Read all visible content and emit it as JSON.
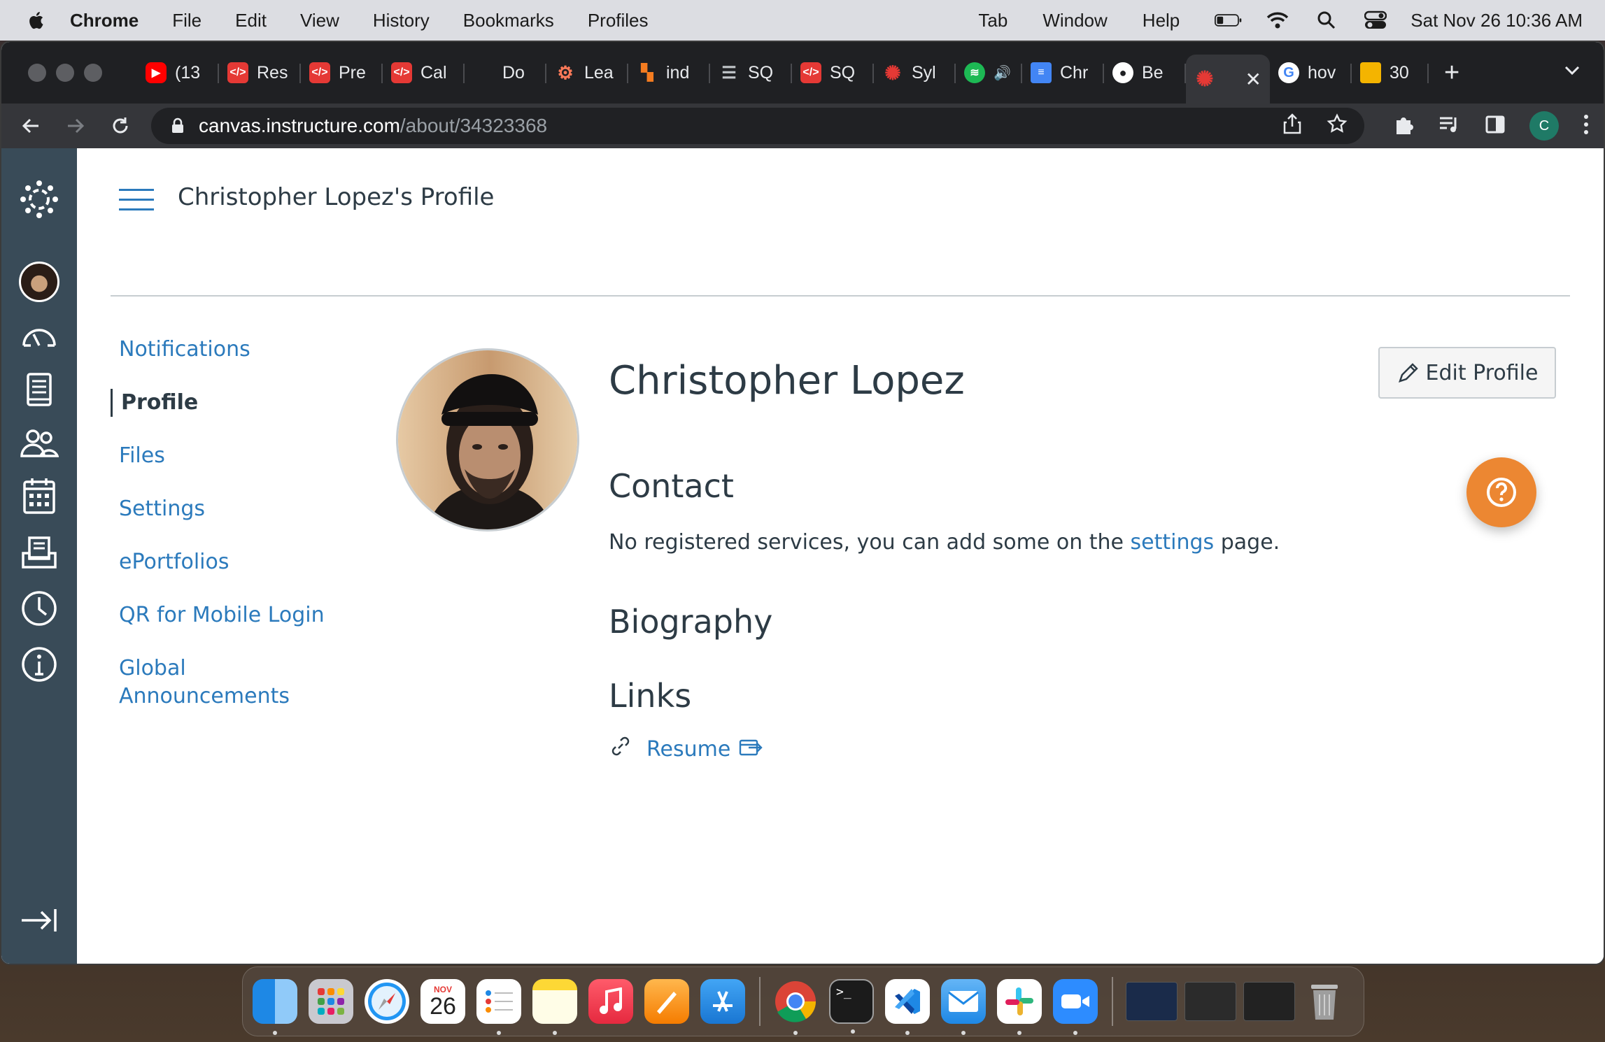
{
  "menubar": {
    "app": "Chrome",
    "items": [
      "File",
      "Edit",
      "View",
      "History",
      "Bookmarks",
      "Profiles"
    ],
    "right_items": [
      "Tab",
      "Window",
      "Help"
    ],
    "datetime": "Sat Nov 26  10:36 AM"
  },
  "tabs": [
    {
      "label": "(13",
      "icon": "youtube-icon",
      "color": "#ff0000"
    },
    {
      "label": "Res",
      "icon": "code-shield-icon",
      "color": "#e53935"
    },
    {
      "label": "Pre",
      "icon": "code-shield-icon",
      "color": "#e53935"
    },
    {
      "label": "Cal",
      "icon": "code-shield-icon",
      "color": "#e53935"
    },
    {
      "label": "Do",
      "icon": "blank-icon",
      "color": "#1f2023"
    },
    {
      "label": "Lea",
      "icon": "hubspot-icon",
      "color": "#ff7a59"
    },
    {
      "label": "ind",
      "icon": "orange-squares-icon",
      "color": "#f47c20"
    },
    {
      "label": "SQ",
      "icon": "database-icon",
      "color": "#9aa0a6"
    },
    {
      "label": "SQ",
      "icon": "code-shield-icon",
      "color": "#e53935"
    },
    {
      "label": "Syl",
      "icon": "canvas-icon",
      "color": "#e53935"
    },
    {
      "label": "",
      "icon": "spotify-icon",
      "color": "#1db954"
    },
    {
      "label": "Chr",
      "icon": "docs-icon",
      "color": "#4285f4"
    },
    {
      "label": "Be",
      "icon": "github-icon",
      "color": "#ffffff"
    },
    {
      "label": "",
      "icon": "canvas-icon",
      "color": "#e53935",
      "active": true
    },
    {
      "label": "hov",
      "icon": "google-icon",
      "color": "#ffffff"
    },
    {
      "label": "30",
      "icon": "slides-icon",
      "color": "#f4b400"
    }
  ],
  "address": {
    "host": "canvas.instructure.com",
    "path": "/about/34323368"
  },
  "profile_initial": "C",
  "page": {
    "title": "Christopher Lopez's Profile",
    "subnav": [
      {
        "label": "Notifications",
        "active": false
      },
      {
        "label": "Profile",
        "active": true
      },
      {
        "label": "Files",
        "active": false
      },
      {
        "label": "Settings",
        "active": false
      },
      {
        "label": "ePortfolios",
        "active": false
      },
      {
        "label": "QR for Mobile Login",
        "active": false
      },
      {
        "label": "Global Announcements",
        "active": false
      }
    ],
    "user_name": "Christopher Lopez",
    "edit_button": "Edit Profile",
    "contact_heading": "Contact",
    "contact_text_before": "No registered services, you can add some on the ",
    "contact_link": "settings",
    "contact_text_after": " page.",
    "biography_heading": "Biography",
    "links_heading": "Links",
    "link_resume": "Resume"
  },
  "dock": {
    "calendar_month": "NOV",
    "calendar_day": "26"
  },
  "colors": {
    "canvas_nav": "#394b58",
    "link_blue": "#2b7abc",
    "help_orange": "#ec8732",
    "text_dark": "#2d3b45"
  }
}
